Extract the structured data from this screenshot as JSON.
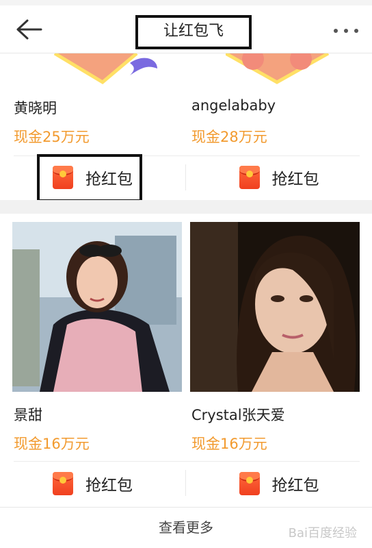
{
  "header": {
    "title": "让红包飞"
  },
  "cards": [
    {
      "name": "黄晓明",
      "cash": "现金25万元",
      "button": "抢红包"
    },
    {
      "name": "angelababy",
      "cash": "现金28万元",
      "button": "抢红包"
    },
    {
      "name": "景甜",
      "cash": "现金16万元",
      "button": "抢红包"
    },
    {
      "name": "Crystal张天爱",
      "cash": "现金16万元",
      "button": "抢红包"
    }
  ],
  "footer": {
    "see_more": "查看更多"
  },
  "watermark": "Bai百度经验",
  "colors": {
    "cash": "#f29a2e",
    "redpacket": "#f0401f",
    "gold": "#ffc93a"
  },
  "icons": [
    "back-arrow-icon",
    "more-icon",
    "red-packet-icon"
  ]
}
